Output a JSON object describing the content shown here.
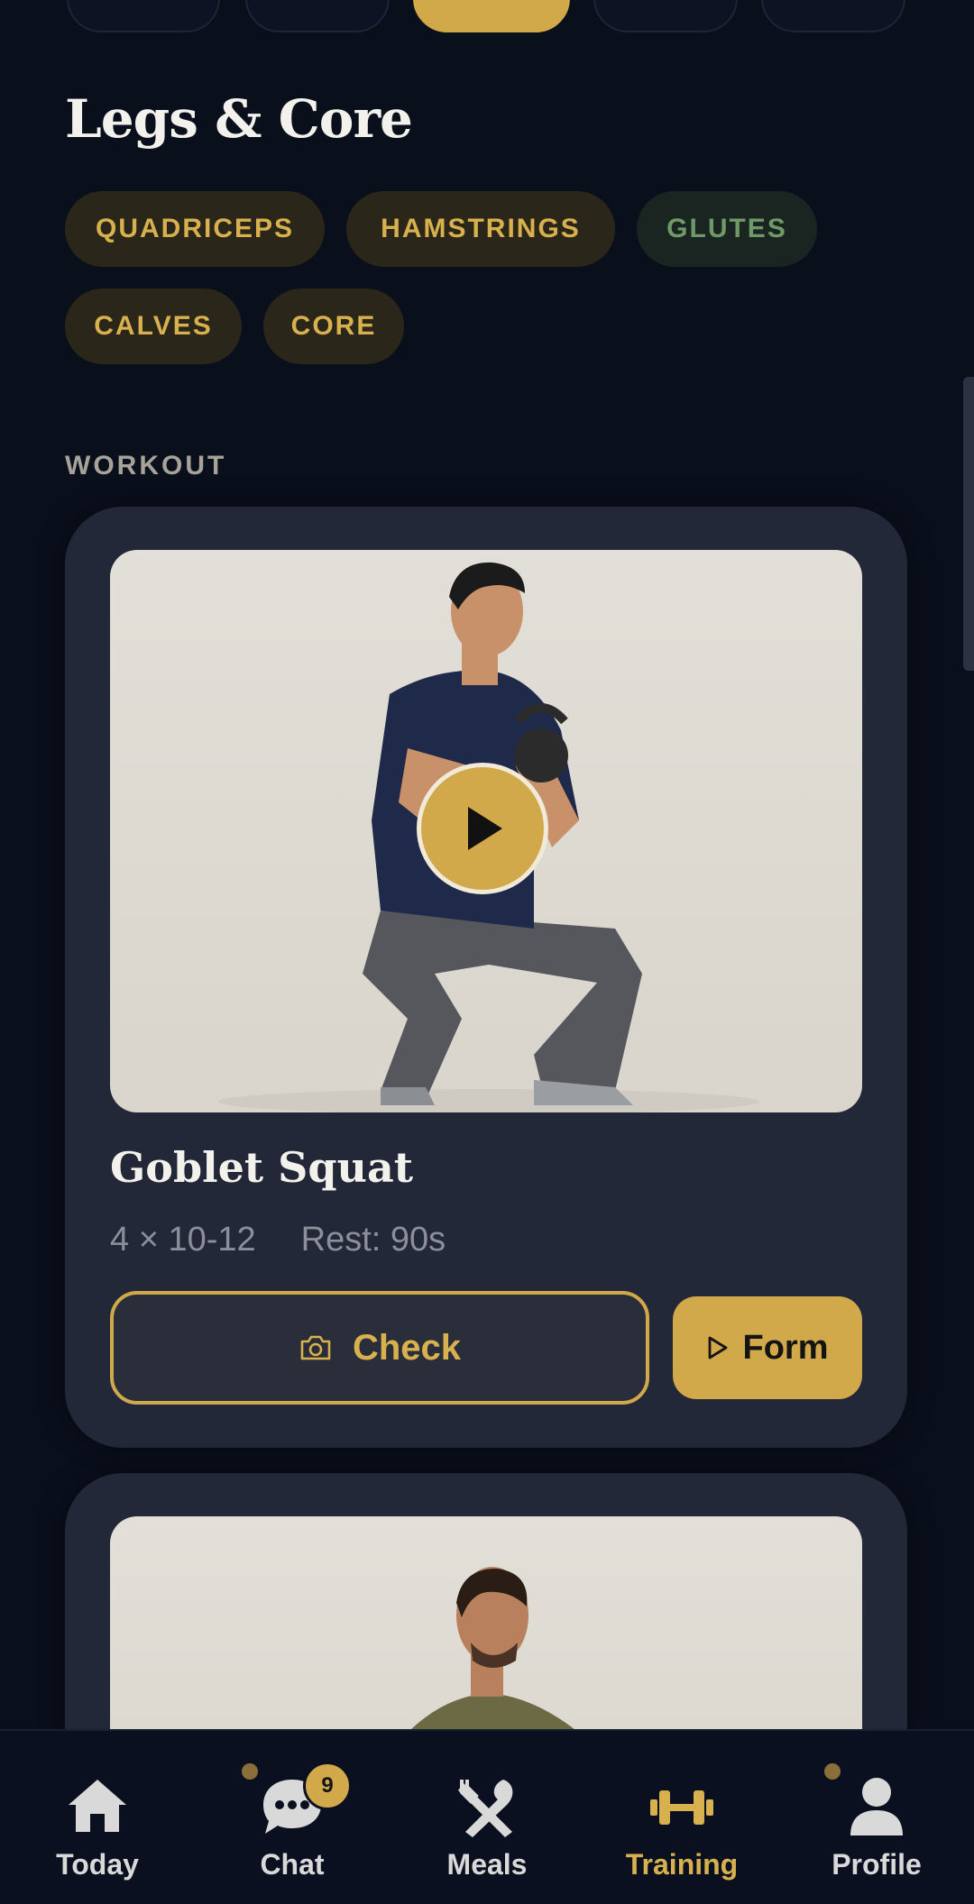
{
  "header": {
    "title": "Legs & Core"
  },
  "muscle_tags": [
    {
      "label": "QUADRICEPS",
      "tone": "active"
    },
    {
      "label": "HAMSTRINGS",
      "tone": "active"
    },
    {
      "label": "GLUTES",
      "tone": "secondary"
    },
    {
      "label": "CALVES",
      "tone": "active"
    },
    {
      "label": "CORE",
      "tone": "active"
    }
  ],
  "section": {
    "label": "WORKOUT"
  },
  "exercises": [
    {
      "name": "Goblet Squat",
      "sets_reps": "4 × 10-12",
      "rest": "Rest: 90s",
      "check_label": "Check",
      "form_label": "Form"
    }
  ],
  "nav": {
    "items": [
      {
        "label": "Today",
        "icon": "home-icon"
      },
      {
        "label": "Chat",
        "icon": "chat-icon",
        "badge": "9"
      },
      {
        "label": "Meals",
        "icon": "utensils-icon"
      },
      {
        "label": "Training",
        "icon": "dumbbell-icon",
        "active": true
      },
      {
        "label": "Profile",
        "icon": "user-icon"
      }
    ]
  },
  "colors": {
    "background": "#0a0f1c",
    "card": "#232838",
    "accent": "#d1a94a",
    "tag_secondary_text": "#6f9a68"
  }
}
